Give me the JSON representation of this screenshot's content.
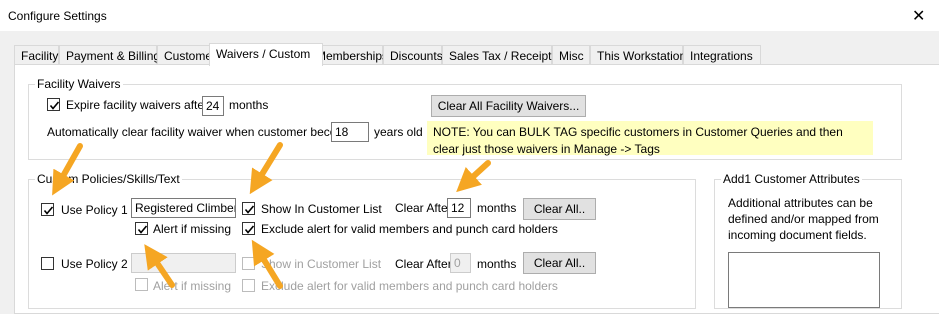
{
  "window": {
    "title": "Configure Settings",
    "close_glyph": "✕"
  },
  "tabs": [
    {
      "label": "Facility"
    },
    {
      "label": "Payment & Billing"
    },
    {
      "label": "Customers"
    },
    {
      "label": "Waivers / Custom",
      "active": true
    },
    {
      "label": "Memberships"
    },
    {
      "label": "Discounts"
    },
    {
      "label": "Sales Tax / Receipt"
    },
    {
      "label": "Misc"
    },
    {
      "label": "This Workstation"
    },
    {
      "label": "Integrations"
    }
  ],
  "facility_waivers": {
    "title": "Facility Waivers",
    "expire_label": "Expire facility waivers after",
    "expire_checked": true,
    "expire_value": "24",
    "expire_unit": "months",
    "clear_all_button": "Clear All Facility Waivers...",
    "auto_clear_label": "Automatically clear facility waiver when customer becomes",
    "auto_clear_value": "18",
    "auto_clear_unit": "years old",
    "note": "NOTE:  You can BULK TAG specific customers in Customer Queries and then clear just those waivers in Manage -> Tags",
    "note_color": "#ffffc0"
  },
  "custom_policies": {
    "title": "Custom Policies/Skills/Text",
    "rows": [
      {
        "use_label": "Use Policy 1",
        "use_checked": true,
        "enabled": true,
        "name_value": "Registered Climber",
        "show_in_list_label": "Show In Customer List",
        "show_in_list_checked": true,
        "clear_after_label": "Clear After",
        "clear_after_value": "12",
        "clear_after_unit": "months",
        "clear_all_button": "Clear All..",
        "alert_label": "Alert if missing",
        "alert_checked": true,
        "exclude_label": "Exclude alert for valid members and punch card holders",
        "exclude_checked": true
      },
      {
        "use_label": "Use Policy 2",
        "use_checked": false,
        "enabled": false,
        "name_value": "",
        "show_in_list_label": "Show in Customer List",
        "show_in_list_checked": false,
        "clear_after_label": "Clear After",
        "clear_after_value": "0",
        "clear_after_unit": "months",
        "clear_all_button": "Clear All..",
        "alert_label": "Alert if missing",
        "alert_checked": false,
        "exclude_label": "Exclude alert for valid members and punch card holders",
        "exclude_checked": false
      }
    ]
  },
  "add1_attributes": {
    "title": "Add1 Customer Attributes",
    "description": "Additional attributes can be defined and/or mapped from incoming document fields."
  },
  "annotation_color": "#f5a623"
}
